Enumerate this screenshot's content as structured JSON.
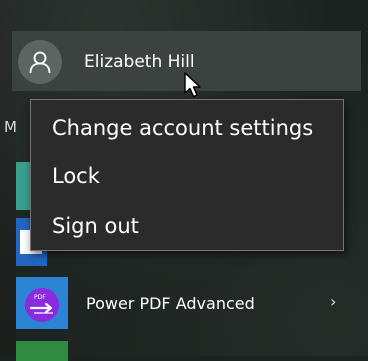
{
  "user": {
    "name": "Elizabeth Hill",
    "avatar_icon": "person-icon"
  },
  "section": {
    "letter": "M"
  },
  "context_menu": {
    "items": [
      "Change account settings",
      "Lock",
      "Sign out"
    ]
  },
  "apps": [
    {
      "label": "Power PDF Advanced",
      "icon": "power-pdf-icon",
      "chevron": "›"
    }
  ],
  "colors": {
    "background": "#1d2320",
    "user_row_highlight": "#3c4240",
    "menu_bg": "#2b2b2b",
    "menu_border": "#767676",
    "pdf_icon_purple": "#8a2be2"
  }
}
